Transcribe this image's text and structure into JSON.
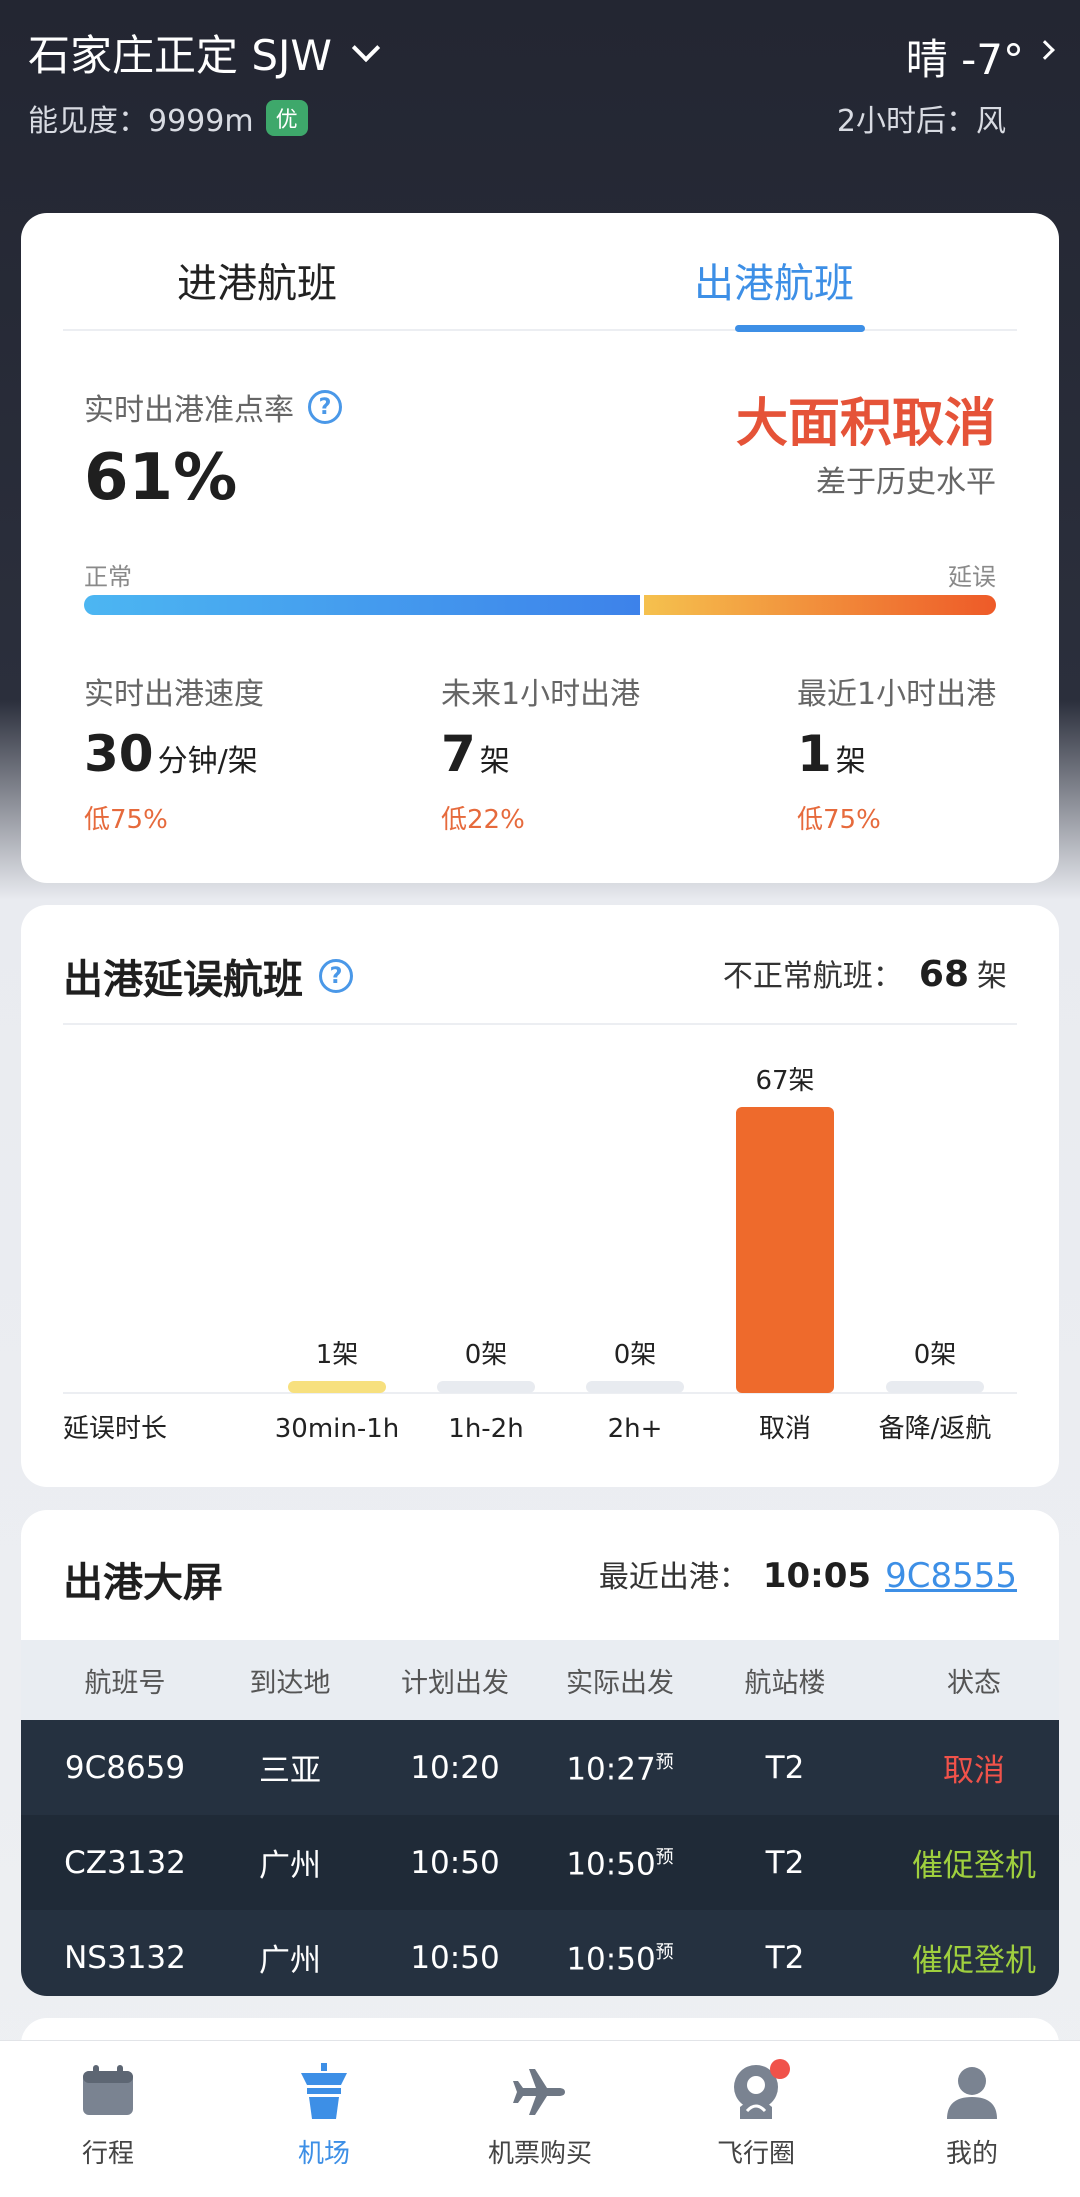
{
  "header": {
    "city": "石家庄正定 SJW",
    "visibility_label": "能见度：9999m",
    "visibility_badge": "优",
    "weather": "晴 -7°",
    "forecast": "2小时后：风"
  },
  "tabs": {
    "arrival": "进港航班",
    "departure": "出港航班",
    "active": "departure"
  },
  "punctuality": {
    "label": "实时出港准点率",
    "value": "61%",
    "status": "大面积取消",
    "compare": "差于历史水平",
    "normal_label": "正常",
    "delay_label": "延误",
    "normal_fraction": 0.61,
    "colors": {
      "status": "#e55338",
      "accent": "#3d8fe6"
    }
  },
  "stats": [
    {
      "label": "实时出港速度",
      "num": "30",
      "unit": "分钟/架",
      "diff": "低75%"
    },
    {
      "label": "未来1小时出港",
      "num": "7",
      "unit": "架",
      "diff": "低22%"
    },
    {
      "label": "最近1小时出港",
      "num": "1",
      "unit": "架",
      "diff": "低75%"
    }
  ],
  "delay_card": {
    "title": "出港延误航班",
    "abnormal_label": "不正常航班：",
    "abnormal_count": "68",
    "abnormal_unit": "架"
  },
  "chart_data": {
    "type": "bar",
    "title": "出港延误航班",
    "xlabel": "延误时长",
    "categories": [
      "30min-1h",
      "1h-2h",
      "2h+",
      "取消",
      "备降/返航"
    ],
    "values": [
      1,
      0,
      0,
      67,
      0
    ],
    "value_labels": [
      "1架",
      "0架",
      "0架",
      "67架",
      "0架"
    ],
    "colors": [
      "#f7e07e",
      "#e8ebf0",
      "#e8ebf0",
      "#ee6a2c",
      "#e8ebf0"
    ],
    "ylim": [
      0,
      67
    ]
  },
  "board": {
    "title": "出港大屏",
    "recent_label": "最近出港：",
    "recent_time": "10:05",
    "recent_flight": "9C8555",
    "columns": [
      "航班号",
      "到达地",
      "计划出发",
      "实际出发",
      "航站楼",
      "状态"
    ],
    "rows": [
      {
        "flight": "9C8659",
        "dest": "三亚",
        "plan": "10:20",
        "actual": "10:27",
        "actual_tag": "预",
        "term": "T2",
        "status": "取消",
        "status_type": "cancel"
      },
      {
        "flight": "CZ3132",
        "dest": "广州",
        "plan": "10:50",
        "actual": "10:50",
        "actual_tag": "预",
        "term": "T2",
        "status": "催促登机",
        "status_type": "board"
      },
      {
        "flight": "NS3132",
        "dest": "广州",
        "plan": "10:50",
        "actual": "10:50",
        "actual_tag": "预",
        "term": "T2",
        "status": "催促登机",
        "status_type": "board"
      }
    ]
  },
  "nav": [
    {
      "label": "行程",
      "icon": "calendar-icon"
    },
    {
      "label": "机场",
      "icon": "control-tower-icon",
      "active": true
    },
    {
      "label": "机票购买",
      "icon": "airplane-icon"
    },
    {
      "label": "飞行圈",
      "icon": "community-icon",
      "badge": true
    },
    {
      "label": "我的",
      "icon": "profile-icon"
    }
  ]
}
